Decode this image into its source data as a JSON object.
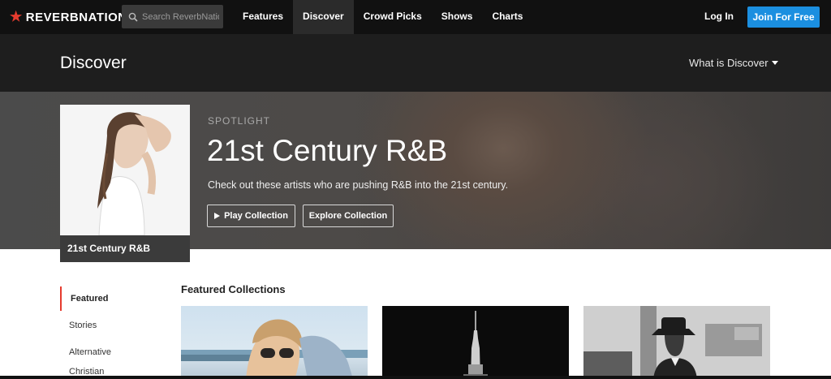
{
  "brand": {
    "name": "REVERBNATION",
    "tm": "®",
    "accent": "#e63b2e"
  },
  "search": {
    "placeholder": "Search ReverbNation"
  },
  "nav": {
    "items": [
      {
        "label": "Features",
        "active": false
      },
      {
        "label": "Discover",
        "active": true
      },
      {
        "label": "Crowd Picks",
        "active": false
      },
      {
        "label": "Shows",
        "active": false
      },
      {
        "label": "Charts",
        "active": false
      }
    ],
    "login_label": "Log In",
    "join_label": "Join For Free",
    "join_color": "#1b8fe0"
  },
  "subheader": {
    "title": "Discover",
    "what_is": "What is Discover"
  },
  "hero": {
    "eyebrow": "SPOTLIGHT",
    "title": "21st Century R&B",
    "description": "Check out these artists who are pushing R&B into the 21st century.",
    "play_label": "Play Collection",
    "explore_label": "Explore Collection",
    "cover_caption": "21st Century R&B"
  },
  "sidebar": {
    "items": [
      {
        "label": "Featured",
        "active": true
      },
      {
        "label": "Stories",
        "active": false
      },
      {
        "label": "Alternative",
        "active": false
      },
      {
        "label": "Christian",
        "active": false
      }
    ]
  },
  "featured": {
    "title": "Featured Collections"
  }
}
